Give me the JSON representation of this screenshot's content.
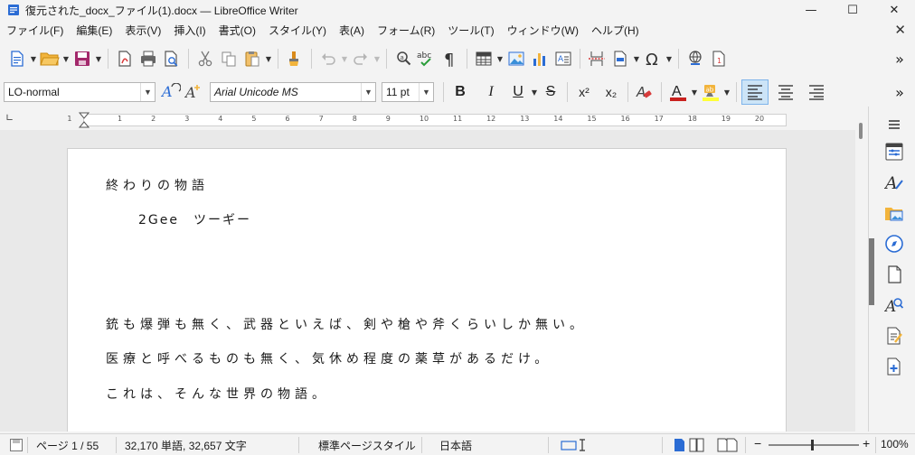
{
  "window": {
    "title": "復元された_docx_ファイル(1).docx — LibreOffice Writer",
    "minimize": "—",
    "maximize": "☐",
    "close": "✕"
  },
  "menu": {
    "items": [
      "ファイル(F)",
      "編集(E)",
      "表示(V)",
      "挿入(I)",
      "書式(O)",
      "スタイル(Y)",
      "表(A)",
      "フォーム(R)",
      "ツール(T)",
      "ウィンドウ(W)",
      "ヘルプ(H)"
    ],
    "close_doc": "✕"
  },
  "toolbar": {
    "more": "»"
  },
  "format_bar": {
    "paragraph_style": "LO-normal",
    "font_name": "Arial Unicode MS",
    "font_size": "11 pt",
    "bold": "B",
    "italic": "I",
    "underline": "U",
    "strike": "S",
    "superscript": "x²",
    "subscript": "x₂",
    "more": "»"
  },
  "ruler": {
    "ticks": [
      "1",
      "2",
      "3",
      "4",
      "5",
      "6",
      "7",
      "8",
      "9",
      "10",
      "11",
      "12",
      "13",
      "14",
      "15",
      "16",
      "17",
      "18",
      "19",
      "20"
    ],
    "left_marker": "1"
  },
  "document": {
    "paragraphs": [
      "終わりの物語",
      "2Gee　ツーギー",
      "銃も爆弾も無く、武器といえば、剣や槍や斧くらいしか無い。",
      "医療と呼べるものも無く、気休め程度の薬草があるだけ。",
      "これは、そんな世界の物語。"
    ]
  },
  "status": {
    "page": "ページ 1 / 55",
    "words": "32,170 単語, 32,657 文字",
    "page_style": "標準ページスタイル",
    "language": "日本語",
    "zoom": "100%",
    "zoom_minus": "−",
    "zoom_plus": "+"
  },
  "colors": {
    "font_color": "#c9211e",
    "highlight": "#ffff38",
    "accent": "#1e6fc9"
  }
}
